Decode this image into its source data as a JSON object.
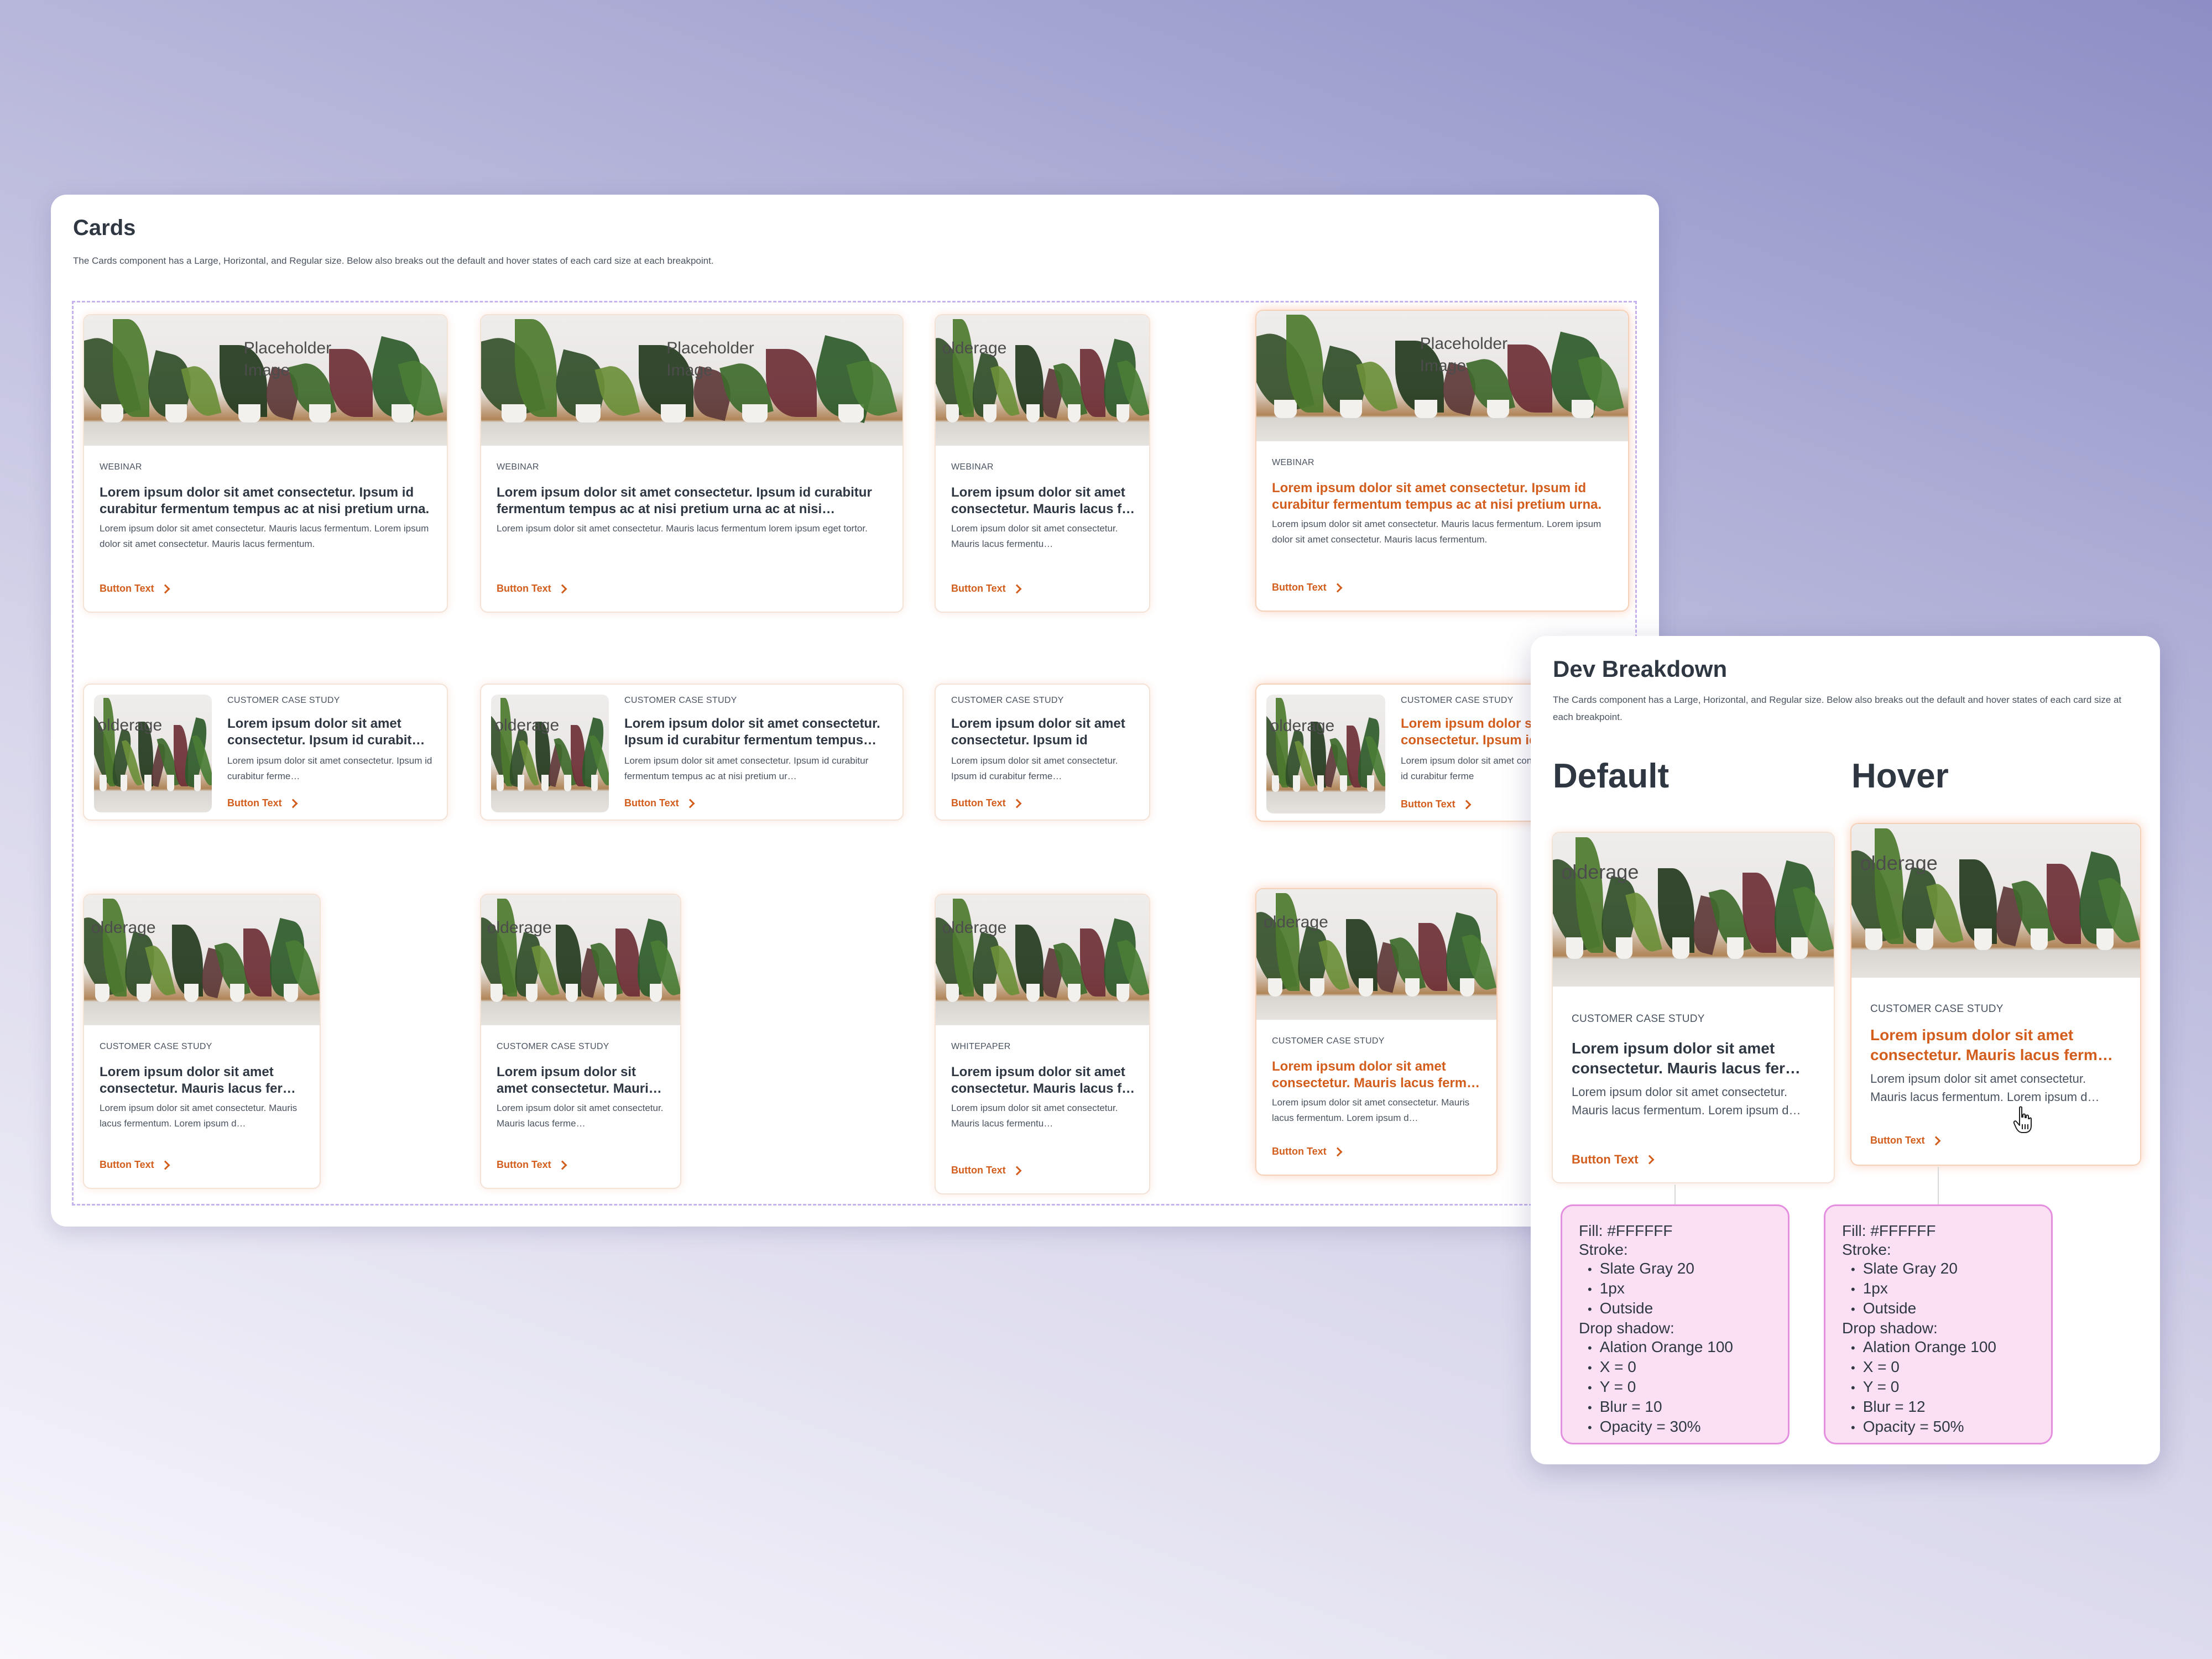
{
  "main_panel": {
    "title": "Cards",
    "description": "The Cards component has a Large, Horizontal, and Regular size. Below also breaks out the default and hover states of each card size at each breakpoint."
  },
  "placeholder_image_text": "Placeholder\nImage",
  "placeholder_image_text_cropped": "olderage",
  "cards_large": [
    {
      "tag": "WEBINAR",
      "title": "Lorem ipsum dolor sit amet consectetur. Ipsum id curabitur fermentum tempus ac at nisi pretium urna.",
      "body": "Lorem ipsum dolor sit amet consectetur. Mauris lacus fermentum. Lorem ipsum dolor sit amet consectetur. Mauris lacus fermentum.",
      "button": "Button Text",
      "state": "default"
    },
    {
      "tag": "WEBINAR",
      "title": "Lorem ipsum dolor sit amet consectetur. Ipsum id curabitur fermentum tempus ac at nisi pretium urna ac at nisi…",
      "body": "Lorem ipsum dolor sit amet consectetur. Mauris lacus fermentum lorem ipsum eget tortor.",
      "button": "Button Text",
      "state": "default"
    },
    {
      "tag": "WEBINAR",
      "title": "Lorem ipsum dolor sit amet consectetur. Mauris lacus f…",
      "body": "Lorem ipsum dolor sit amet consectetur. Mauris lacus fermentu…",
      "button": "Button Text",
      "state": "default"
    },
    {
      "tag": "WEBINAR",
      "title": "Lorem ipsum dolor sit amet consectetur. Ipsum id curabitur fermentum tempus ac at nisi pretium urna.",
      "body": "Lorem ipsum dolor sit amet consectetur. Mauris lacus fermentum. Lorem ipsum dolor sit amet consectetur. Mauris lacus fermentum.",
      "button": "Button Text",
      "state": "hover"
    }
  ],
  "cards_horizontal": [
    {
      "tag": "CUSTOMER CASE STUDY",
      "title": "Lorem ipsum dolor sit amet consectetur. Ipsum id curabit…",
      "body": "Lorem ipsum dolor sit amet consectetur. Ipsum id curabitur ferme…",
      "button": "Button Text",
      "state": "default"
    },
    {
      "tag": "CUSTOMER CASE STUDY",
      "title": "Lorem ipsum dolor sit amet consectetur. Ipsum id curabitur fermentum tempus…",
      "body": "Lorem ipsum dolor sit amet consectetur. Ipsum id curabitur fermentum tempus ac at nisi pretium ur…",
      "button": "Button Text",
      "state": "default"
    },
    {
      "tag": "CUSTOMER CASE STUDY",
      "title": "Lorem ipsum dolor sit amet consectetur. Ipsum id curabit…",
      "body": "Lorem ipsum dolor sit amet consectetur. Ipsum id curabitur ferme…",
      "button": "Button Text",
      "state": "default"
    },
    {
      "tag": "CUSTOMER CASE STUDY",
      "title": "Lorem ipsum dolor sit amet consectetur. Ipsum id",
      "body": "Lorem ipsum dolor sit amet consectetur. Ipsum id curabitur ferme",
      "button": "Button Text",
      "state": "hover"
    }
  ],
  "cards_regular": [
    {
      "tag": "CUSTOMER CASE STUDY",
      "title": "Lorem ipsum dolor sit amet consectetur. Mauris lacus fer…",
      "body": "Lorem ipsum dolor sit amet consectetur. Mauris lacus fermentum. Lorem ipsum d…",
      "button": "Button Text",
      "state": "default"
    },
    {
      "tag": "CUSTOMER CASE STUDY",
      "title": "Lorem ipsum dolor sit amet consectetur. Mauri…",
      "body": "Lorem ipsum dolor sit amet consectetur. Mauris lacus ferme…",
      "button": "Button Text",
      "state": "default"
    },
    {
      "tag": "WHITEPAPER",
      "title": "Lorem ipsum dolor sit amet consectetur. Mauris lacus f…",
      "body": "Lorem ipsum dolor sit amet consectetur. Mauris lacus fermentu…",
      "button": "Button Text",
      "state": "default"
    },
    {
      "tag": "CUSTOMER CASE STUDY",
      "title": "Lorem ipsum dolor sit amet consectetur. Mauris lacus ferm…",
      "body": "Lorem ipsum dolor sit amet consectetur. Mauris lacus fermentum. Lorem ipsum d…",
      "button": "Button Text",
      "state": "hover"
    }
  ],
  "dev_panel": {
    "title": "Dev Breakdown",
    "description": "The Cards component has a Large, Horizontal, and Regular size. Below also breaks out the default and hover states of each card size at each breakpoint.",
    "default_heading": "Default",
    "hover_heading": "Hover",
    "default_card": {
      "tag": "CUSTOMER CASE STUDY",
      "title": "Lorem ipsum dolor sit amet consectetur. Mauris lacus fer…",
      "body": "Lorem ipsum dolor sit amet consectetur. Mauris lacus fermentum. Lorem ipsum d…",
      "button": "Button Text"
    },
    "hover_card": {
      "tag": "CUSTOMER CASE STUDY",
      "title": "Lorem ipsum dolor sit amet consectetur. Mauris lacus ferm…",
      "body": "Lorem ipsum dolor sit amet consectetur. Mauris lacus fermentum. Lorem ipsum d…",
      "button": "Button Text"
    },
    "default_spec": {
      "fill": "Fill: #FFFFFF",
      "stroke_label": "Stroke:",
      "stroke": [
        "Slate Gray 20",
        "1px",
        "Outside"
      ],
      "shadow_label": "Drop shadow:",
      "shadow": [
        "Alation Orange 100",
        "X = 0",
        "Y = 0",
        "Blur = 10",
        "Opacity = 30%"
      ]
    },
    "hover_spec": {
      "fill": "Fill: #FFFFFF",
      "stroke_label": "Stroke:",
      "stroke": [
        "Slate Gray 20",
        "1px",
        "Outside"
      ],
      "shadow_label": "Drop shadow:",
      "shadow": [
        "Alation Orange 100",
        "X = 0",
        "Y = 0",
        "Blur = 12",
        "Opacity = 50%"
      ]
    }
  },
  "colors": {
    "accent_orange": "#d35d1c",
    "text_dark": "#2e3742",
    "note_fill": "#fbe0f4",
    "note_border": "#e48ee0",
    "dashed_frame": "#c6b3ee"
  },
  "icons": {
    "button_chevron": "chevron-right-icon",
    "cursor": "hand-pointer-icon"
  }
}
